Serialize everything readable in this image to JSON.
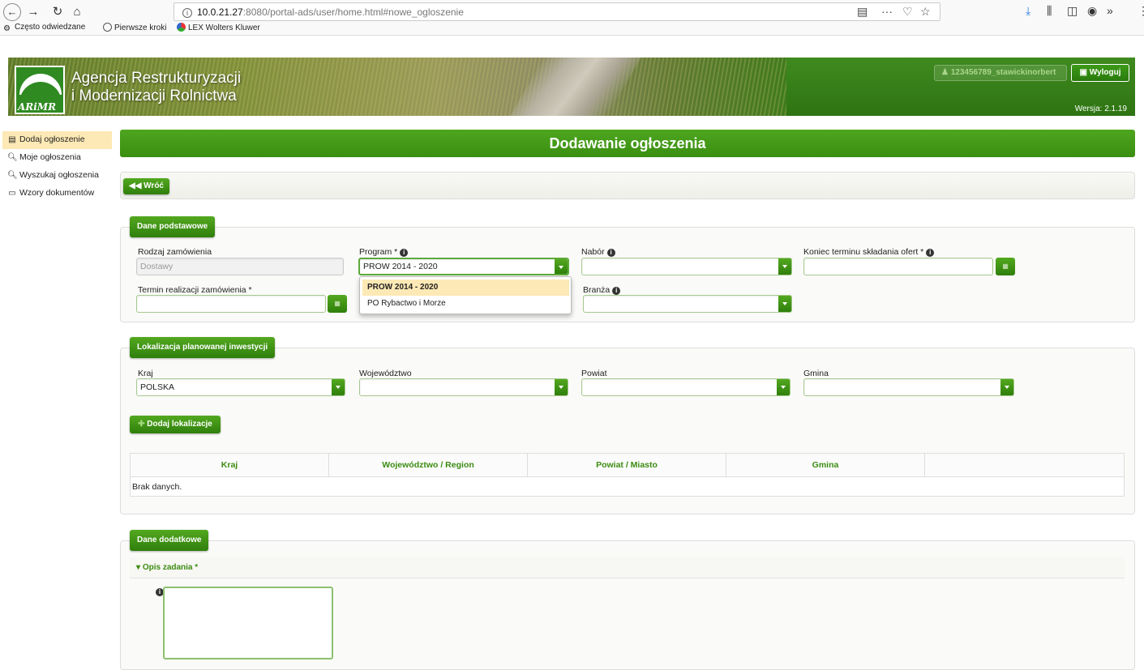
{
  "browser": {
    "url_host": "10.0.21.27",
    "url_path": ":8080/portal-ads/user/home.html#nowe_ogloszenie",
    "bookmarks": [
      "Często odwiedzane",
      "Pierwsze kroki",
      "LEX Wolters Kluwer"
    ]
  },
  "header": {
    "logo_text": "ARiMR",
    "agency_line1": "Agencja Restrukturyzacji",
    "agency_line2": "i Modernizacji Rolnictwa",
    "user": "123456789_stawickinorbert",
    "logout": "Wyloguj",
    "version": "Wersja: 2.1.19"
  },
  "sidebar": {
    "items": [
      {
        "label": "Dodaj ogłoszenie",
        "icon": "document-icon"
      },
      {
        "label": "Moje ogłoszenia",
        "icon": "search-icon"
      },
      {
        "label": "Wyszukaj ogłoszenia",
        "icon": "search-icon"
      },
      {
        "label": "Wzory dokumentów",
        "icon": "folder-icon"
      }
    ]
  },
  "page_title": "Dodawanie ogłoszenia",
  "back_label": "Wróć",
  "dane_podstawowe": {
    "title": "Dane podstawowe",
    "rodzaj_label": "Rodzaj zamówienia",
    "rodzaj_value": "Dostawy",
    "program_label": "Program *",
    "program_value": "PROW 2014 - 2020",
    "program_options": [
      "PROW 2014 - 2020",
      "PO Rybactwo i Morze"
    ],
    "nabor_label": "Nabór",
    "koniec_label": "Koniec terminu składania ofert *",
    "termin_label": "Termin realizacji zamówienia *",
    "branza_label": "Branża"
  },
  "lokalizacja": {
    "title": "Lokalizacja planowanej inwestycji",
    "kraj_label": "Kraj",
    "kraj_value": "POLSKA",
    "wojewodztwo_label": "Województwo",
    "powiat_label": "Powiat",
    "gmina_label": "Gmina",
    "add_button": "Dodaj lokalizacje",
    "table_headers": [
      "Kraj",
      "Województwo / Region",
      "Powiat / Miasto",
      "Gmina",
      ""
    ],
    "no_data": "Brak danych."
  },
  "dane_dodatkowe": {
    "title": "Dane dodatkowe",
    "opis_label": "Opis zadania *"
  },
  "colors": {
    "brand_green": "#3a8e11",
    "highlight": "#fde9b5"
  }
}
